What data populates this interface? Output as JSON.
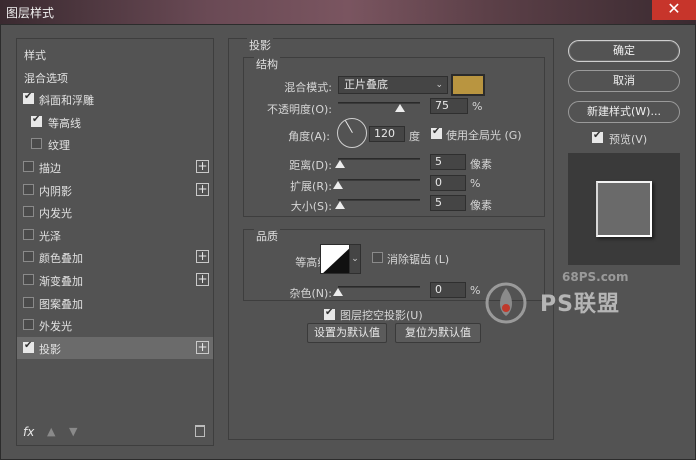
{
  "window": {
    "title": "图层样式",
    "close_glyph": "✕"
  },
  "style_list": {
    "items": [
      {
        "label": "样式",
        "checkbox": false,
        "checked": false,
        "plus": false,
        "indent": false,
        "selected": false
      },
      {
        "label": "混合选项",
        "checkbox": false,
        "checked": false,
        "plus": false,
        "indent": false,
        "selected": false
      },
      {
        "label": "斜面和浮雕",
        "checkbox": true,
        "checked": true,
        "plus": false,
        "indent": false,
        "selected": false
      },
      {
        "label": "等高线",
        "checkbox": true,
        "checked": true,
        "plus": false,
        "indent": true,
        "selected": false
      },
      {
        "label": "纹理",
        "checkbox": true,
        "checked": false,
        "plus": false,
        "indent": true,
        "selected": false
      },
      {
        "label": "描边",
        "checkbox": true,
        "checked": false,
        "plus": true,
        "indent": false,
        "selected": false
      },
      {
        "label": "内阴影",
        "checkbox": true,
        "checked": false,
        "plus": true,
        "indent": false,
        "selected": false
      },
      {
        "label": "内发光",
        "checkbox": true,
        "checked": false,
        "plus": false,
        "indent": false,
        "selected": false
      },
      {
        "label": "光泽",
        "checkbox": true,
        "checked": false,
        "plus": false,
        "indent": false,
        "selected": false
      },
      {
        "label": "颜色叠加",
        "checkbox": true,
        "checked": false,
        "plus": true,
        "indent": false,
        "selected": false
      },
      {
        "label": "渐变叠加",
        "checkbox": true,
        "checked": false,
        "plus": true,
        "indent": false,
        "selected": false
      },
      {
        "label": "图案叠加",
        "checkbox": true,
        "checked": false,
        "plus": false,
        "indent": false,
        "selected": false
      },
      {
        "label": "外发光",
        "checkbox": true,
        "checked": false,
        "plus": false,
        "indent": false,
        "selected": false
      },
      {
        "label": "投影",
        "checkbox": true,
        "checked": true,
        "plus": true,
        "indent": false,
        "selected": true
      }
    ],
    "footer": {
      "fx_label": "fx",
      "up_glyph": "▲",
      "down_glyph": "▼"
    }
  },
  "drop_shadow": {
    "section_title": "投影",
    "structure": {
      "title": "结构",
      "blend_mode_label": "混合模式:",
      "blend_mode_value": "正片叠底",
      "shadow_color": "#b99540",
      "opacity_label": "不透明度(O):",
      "opacity_value": "75",
      "opacity_unit": "%",
      "angle_label": "角度(A):",
      "angle_value": "120",
      "angle_unit": "度",
      "global_light_label": "使用全局光 (G)",
      "global_light_checked": true,
      "distance_label": "距离(D):",
      "distance_value": "5",
      "distance_unit": "像素",
      "spread_label": "扩展(R):",
      "spread_value": "0",
      "spread_unit": "%",
      "size_label": "大小(S):",
      "size_value": "5",
      "size_unit": "像素"
    },
    "quality": {
      "title": "品质",
      "contour_label": "等高线:",
      "antialias_label": "消除锯齿 (L)",
      "antialias_checked": false,
      "noise_label": "杂色(N):",
      "noise_value": "0",
      "noise_unit": "%"
    },
    "knockout_label": "图层挖空投影(U)",
    "knockout_checked": true,
    "make_default_label": "设置为默认值",
    "reset_default_label": "复位为默认值"
  },
  "actions": {
    "ok_label": "确定",
    "cancel_label": "取消",
    "new_style_label": "新建样式(W)...",
    "preview_label": "预览(V)",
    "preview_checked": true
  },
  "watermark": {
    "site": "68PS.com",
    "brand": "PS联盟"
  },
  "icons": [
    "close-icon",
    "checkbox-icon",
    "plus-icon",
    "fx-icon",
    "arrow-up-icon",
    "arrow-down-icon",
    "trash-icon",
    "chevron-down-icon",
    "angle-dial-icon",
    "contour-icon",
    "logo-icon"
  ]
}
